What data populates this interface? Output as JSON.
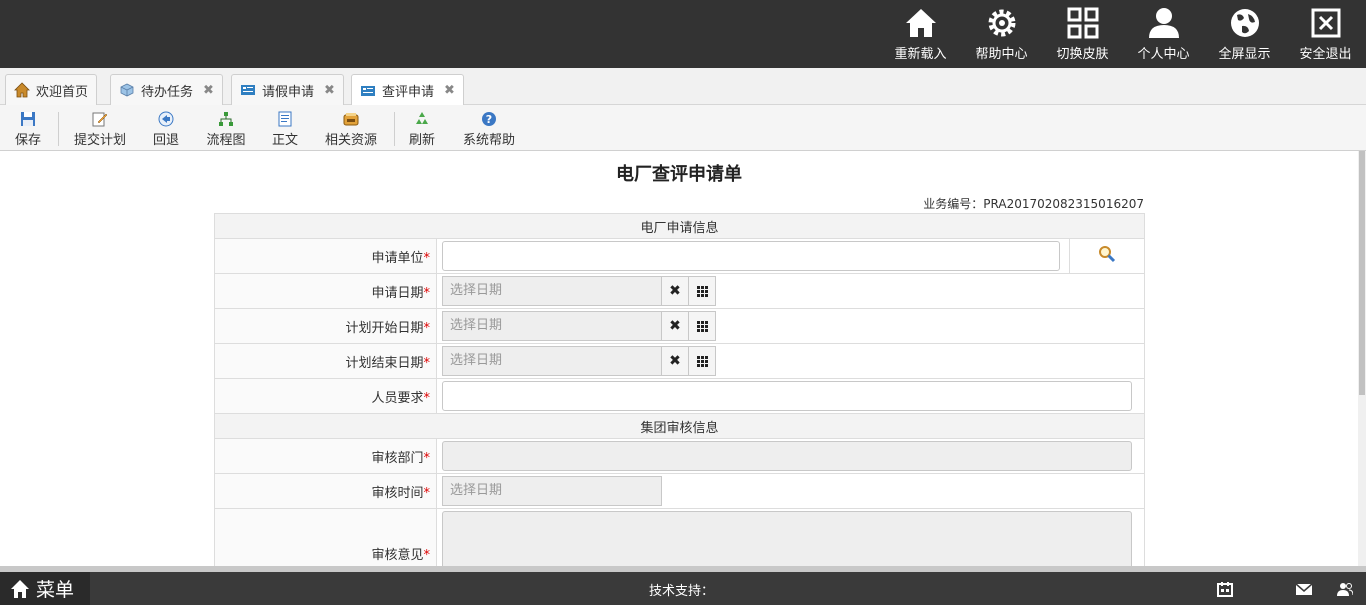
{
  "topnav": {
    "items": [
      {
        "label": "重新载入",
        "icon": "home-icon"
      },
      {
        "label": "帮助中心",
        "icon": "gear-icon"
      },
      {
        "label": "切换皮肤",
        "icon": "grid-icon"
      },
      {
        "label": "个人中心",
        "icon": "user-icon"
      },
      {
        "label": "全屏显示",
        "icon": "globe-icon"
      },
      {
        "label": "安全退出",
        "icon": "close-box-icon"
      }
    ]
  },
  "tabs": [
    {
      "label": "欢迎首页",
      "icon": "home-icon",
      "closable": false
    },
    {
      "label": "待办任务",
      "icon": "task-icon",
      "closable": true
    },
    {
      "label": "请假申请",
      "icon": "form-icon",
      "closable": true
    },
    {
      "label": "查评申请",
      "icon": "form-icon",
      "closable": true,
      "active": true
    }
  ],
  "toolbar": {
    "save": "保存",
    "submit": "提交计划",
    "back": "回退",
    "flowchart": "流程图",
    "text": "正文",
    "resources": "相关资源",
    "refresh": "刷新",
    "help": "系统帮助"
  },
  "form": {
    "title": "电厂查评申请单",
    "biz_no": "业务编号：PRA201702082315016207",
    "section1": "电厂申请信息",
    "section2": "集团审核信息",
    "required_mark": "*",
    "fields": {
      "apply_unit": {
        "label": "申请单位",
        "value": ""
      },
      "apply_date": {
        "label": "申请日期",
        "placeholder": "选择日期"
      },
      "plan_start": {
        "label": "计划开始日期",
        "placeholder": "选择日期"
      },
      "plan_end": {
        "label": "计划结束日期",
        "placeholder": "选择日期"
      },
      "staff_req": {
        "label": "人员要求",
        "value": ""
      },
      "review_dept": {
        "label": "审核部门",
        "value": ""
      },
      "review_time": {
        "label": "审核时间",
        "placeholder": "选择日期"
      },
      "review_opinion": {
        "label": "审核意见",
        "value": ""
      }
    },
    "clear_glyph": "✖"
  },
  "bottombar": {
    "menu": "菜单",
    "support": "技术支持："
  },
  "colors": {
    "topbar_bg": "#333333",
    "required": "#dd0000"
  }
}
